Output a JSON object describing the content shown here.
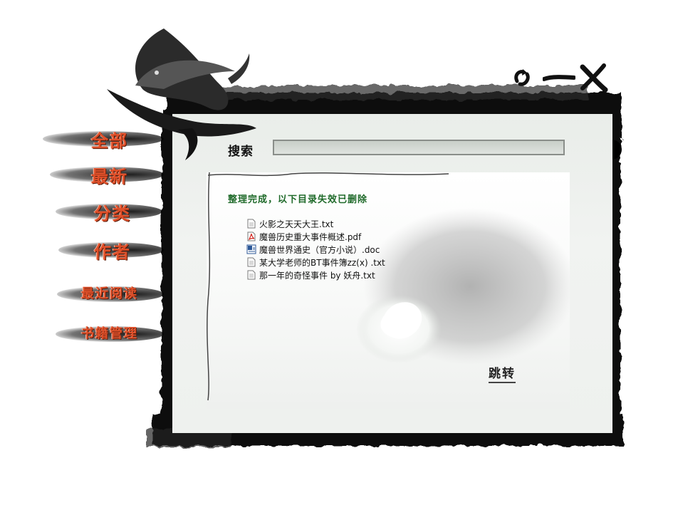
{
  "search": {
    "label": "搜索",
    "value": "",
    "placeholder": ""
  },
  "status_message": "整理完成，以下目录失效已删除",
  "files": [
    {
      "name": "火影之天天大王.txt",
      "type": "txt-icon"
    },
    {
      "name": "魔兽历史重大事件概述.pdf",
      "type": "pdf-icon"
    },
    {
      "name": "魔兽世界通史（官方小说）.doc",
      "type": "doc-icon"
    },
    {
      "name": "某大学老师的BT事件簿zz(x) .txt",
      "type": "txt-icon"
    },
    {
      "name": "那一年的奇怪事件 by 妖舟.txt",
      "type": "txt-icon"
    }
  ],
  "jump_label": "跳转",
  "nav": {
    "all": "全部",
    "latest": "最新",
    "category": "分类",
    "author": "作者",
    "recent_reading": "最近阅读",
    "book_management": "书籍管理"
  },
  "window_controls": [
    "refresh-icon",
    "minimize-icon",
    "close-icon"
  ],
  "colors": {
    "nav_text": "#e0502a",
    "status_text": "#1f6a2a",
    "ink": "#000000"
  }
}
